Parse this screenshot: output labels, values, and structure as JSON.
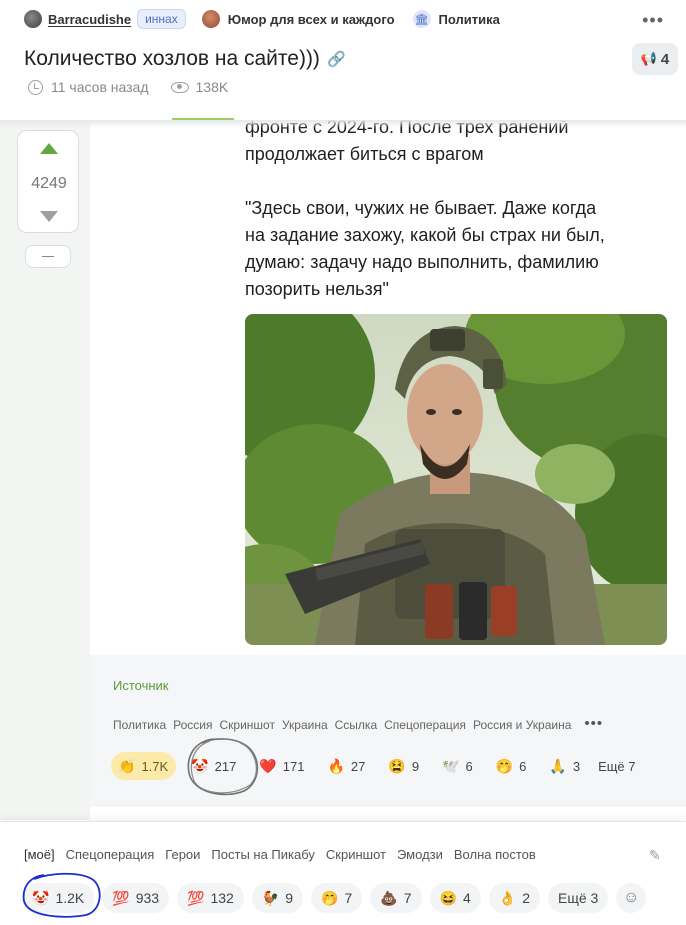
{
  "header": {
    "author": "Barracudishe",
    "author_badge": "иннах",
    "community": "Юмор для всех и каждого",
    "tag": "Политика",
    "title": "Количество хозлов на сайте)))",
    "comments_count": "4",
    "time_ago": "11 часов назад",
    "views": "138K",
    "icons": [
      "user-avatar",
      "community-avatar",
      "bank-icon",
      "more-dots-icon",
      "link-icon",
      "megaphone-icon",
      "clock-icon",
      "eye-icon"
    ]
  },
  "vote": {
    "rating": "4249",
    "minus_label": "–"
  },
  "content": {
    "lines": [
      "фронте с 2024-го. После трех ранений",
      "продолжает биться с врагом",
      "\"Здесь свои, чужих не бывает. Даже когда",
      "на задание захожу, какой бы страх ни был,",
      "думаю: задачу надо выполнить, фамилию",
      "позорить нельзя\""
    ]
  },
  "footer": {
    "source_label": "Источник",
    "tags": [
      "Политика",
      "Россия",
      "Скриншот",
      "Украина",
      "Ссылка",
      "Спецоперация",
      "Россия и Украина"
    ],
    "reactions": [
      {
        "emoji": "👏",
        "count": "1.7K",
        "active": true
      },
      {
        "emoji": "🤡",
        "count": "217",
        "active": false
      },
      {
        "emoji": "❤️",
        "count": "171",
        "active": false
      },
      {
        "emoji": "🔥",
        "count": "27",
        "active": false
      },
      {
        "emoji": "😫",
        "count": "9",
        "active": false
      },
      {
        "emoji": "🕊️",
        "count": "6",
        "active": false
      },
      {
        "emoji": "🤭",
        "count": "6",
        "active": false
      },
      {
        "emoji": "🙏",
        "count": "3",
        "active": false
      }
    ],
    "more_label": "Ещё 7"
  },
  "panel": {
    "categories": [
      "[моё]",
      "Спецоперация",
      "Герои",
      "Посты на Пикабу",
      "Скриншот",
      "Эмодзи",
      "Волна постов"
    ],
    "chips": [
      {
        "emoji": "🤡",
        "count": "1.2K"
      },
      {
        "emoji": "💯",
        "count": "933"
      },
      {
        "emoji": "💯",
        "count": "132"
      },
      {
        "emoji": "🐓",
        "count": "9"
      },
      {
        "emoji": "🤭",
        "count": "7"
      },
      {
        "emoji": "💩",
        "count": "7"
      },
      {
        "emoji": "😆",
        "count": "4"
      },
      {
        "emoji": "👌",
        "count": "2"
      }
    ],
    "more_label": "Ещё 3"
  },
  "colors": {
    "accent_green": "#62a83f",
    "active_reaction": "#fbeaa9",
    "annotation_blue": "#1b2fd0"
  }
}
